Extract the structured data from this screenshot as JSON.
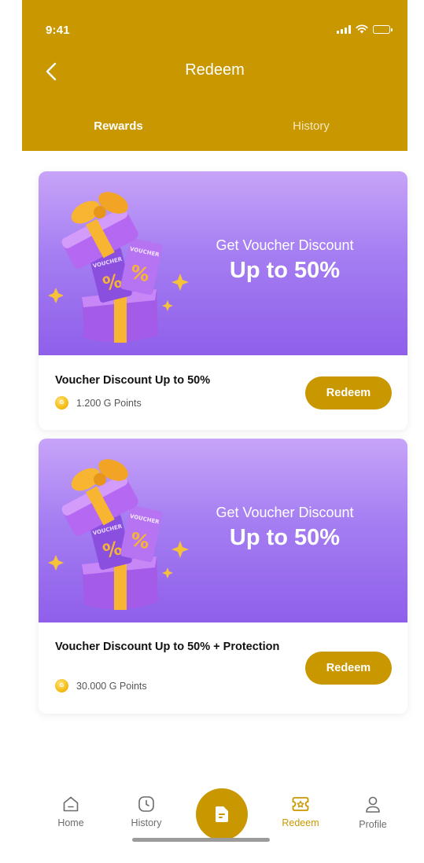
{
  "status_bar": {
    "time": "9:41"
  },
  "header": {
    "title": "Redeem",
    "tabs": [
      {
        "label": "Rewards",
        "active": true
      },
      {
        "label": "History",
        "active": false
      }
    ]
  },
  "rewards": [
    {
      "banner_subtitle": "Get Voucher Discount",
      "banner_title": "Up to 50%",
      "title": "Voucher Discount Up to 50%",
      "points": "1.200 G Points",
      "button_label": "Redeem"
    },
    {
      "banner_subtitle": "Get Voucher Discount",
      "banner_title": "Up to 50%",
      "title": "Voucher Discount Up to 50% + Protection",
      "points": "30.000 G Points",
      "button_label": "Redeem"
    }
  ],
  "coin_symbol": "G",
  "bottom_nav": {
    "items": [
      {
        "label": "Home",
        "icon": "home-icon"
      },
      {
        "label": "History",
        "icon": "clock-icon"
      },
      {
        "label": "Redeem",
        "icon": "ticket-icon",
        "active": true
      },
      {
        "label": "Profile",
        "icon": "user-icon"
      }
    ],
    "center_icon": "document-icon"
  },
  "colors": {
    "primary": "#C99700",
    "banner_top": "#C7A4F8",
    "banner_bottom": "#8F5FEA",
    "nav_inactive": "#6c6c6c"
  }
}
